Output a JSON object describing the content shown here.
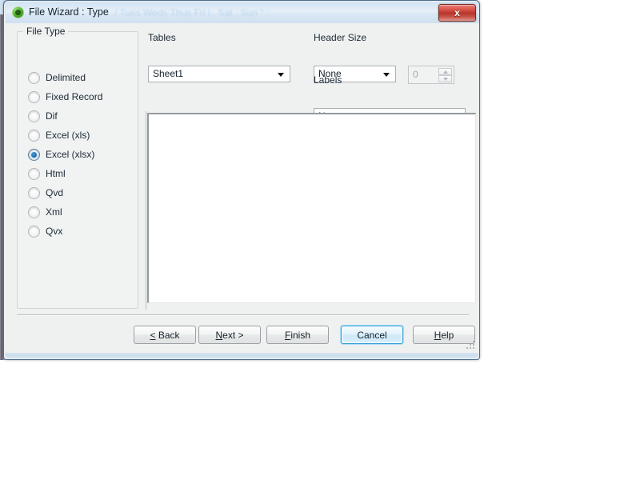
{
  "window": {
    "title": "File Wizard : Type",
    "ghost_text": "/ Tues Weds Thus Fri i , Sat , Sun \" ;",
    "icon_name": "qlikview-app-icon",
    "close_label": "x",
    "accent_focus_color": "#2f9ed6",
    "titlebar_color": "#d3e4f4",
    "close_color": "#b7352b"
  },
  "file_type": {
    "legend": "File Type",
    "selected": "Excel (xlsx)",
    "options": [
      {
        "label": "Delimited",
        "checked": false
      },
      {
        "label": "Fixed Record",
        "checked": false
      },
      {
        "label": "Dif",
        "checked": false
      },
      {
        "label": "Excel (xls)",
        "checked": false
      },
      {
        "label": "Excel (xlsx)",
        "checked": true
      },
      {
        "label": "Html",
        "checked": false
      },
      {
        "label": "Qvd",
        "checked": false
      },
      {
        "label": "Xml",
        "checked": false
      },
      {
        "label": "Qvx",
        "checked": false
      }
    ]
  },
  "fields": {
    "tables": {
      "label": "Tables",
      "value": "Sheet1"
    },
    "header_size": {
      "label": "Header Size",
      "value": "None"
    },
    "header_size_spinner": {
      "value": "0",
      "enabled": false
    },
    "labels": {
      "label": "Labels",
      "value": "None"
    }
  },
  "preview": {
    "content": ""
  },
  "buttons": [
    {
      "name": "back",
      "pre": "",
      "mnemonic": "<",
      "post": " Back",
      "focused": false
    },
    {
      "name": "next",
      "pre": "",
      "mnemonic": "N",
      "post": "ext >",
      "focused": false
    },
    {
      "name": "finish",
      "pre": "",
      "mnemonic": "F",
      "post": "inish",
      "focused": false
    },
    {
      "name": "cancel",
      "pre": "",
      "mnemonic": "",
      "post": "Cancel",
      "focused": true
    },
    {
      "name": "help",
      "pre": "",
      "mnemonic": "H",
      "post": "elp",
      "focused": false
    }
  ]
}
